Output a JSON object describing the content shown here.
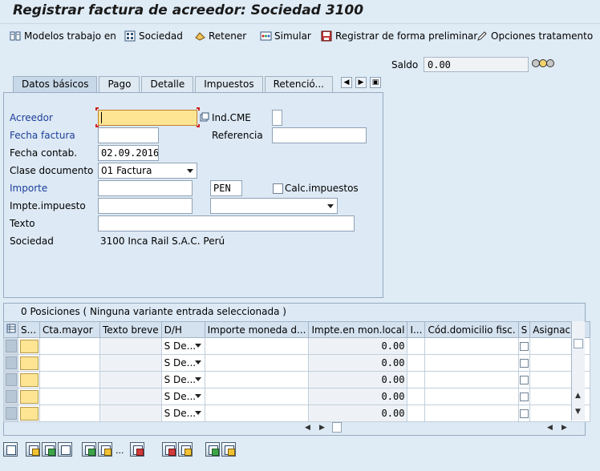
{
  "title": "Registrar factura de acreedor: Sociedad 3100",
  "toolbar": {
    "modelos": "Modelos trabajo en",
    "sociedad": "Sociedad",
    "retener": "Retener",
    "simular": "Simular",
    "preliminar": "Registrar de forma preliminar",
    "opciones": "Opciones tratamento"
  },
  "saldo": {
    "label": "Saldo",
    "value": "0.00"
  },
  "tabs": [
    "Datos básicos",
    "Pago",
    "Detalle",
    "Impuestos",
    "Retenció..."
  ],
  "form": {
    "acreedor_label": "Acreedor",
    "acreedor_value": "",
    "indcme_label": "Ind.CME",
    "fecha_factura_label": "Fecha factura",
    "referencia_label": "Referencia",
    "fecha_contab_label": "Fecha contab.",
    "fecha_contab_value": "02.09.2016",
    "clase_doc_label": "Clase documento",
    "clase_doc_value": "01 Factura",
    "importe_label": "Importe",
    "moneda_value": "PEN",
    "calc_impuestos_label": "Calc.impuestos",
    "impte_impuesto_label": "Impte.impuesto",
    "texto_label": "Texto",
    "sociedad_label": "Sociedad",
    "sociedad_value": "3100 Inca Rail S.A.C. Perú"
  },
  "grid": {
    "title": "0 Posiciones ( Ninguna variante entrada seleccionada )",
    "columns": [
      "S...",
      "Cta.mayor",
      "Texto breve",
      "D/H",
      "Importe moneda d...",
      "Impte.en mon.local",
      "I...",
      "Cód.domicilio fisc.",
      "S",
      "Asignación"
    ],
    "rows": [
      {
        "dh": "S De...",
        "local": "0.00"
      },
      {
        "dh": "S De...",
        "local": "0.00"
      },
      {
        "dh": "S De...",
        "local": "0.00"
      },
      {
        "dh": "S De...",
        "local": "0.00"
      },
      {
        "dh": "S De...",
        "local": "0.00"
      }
    ]
  }
}
